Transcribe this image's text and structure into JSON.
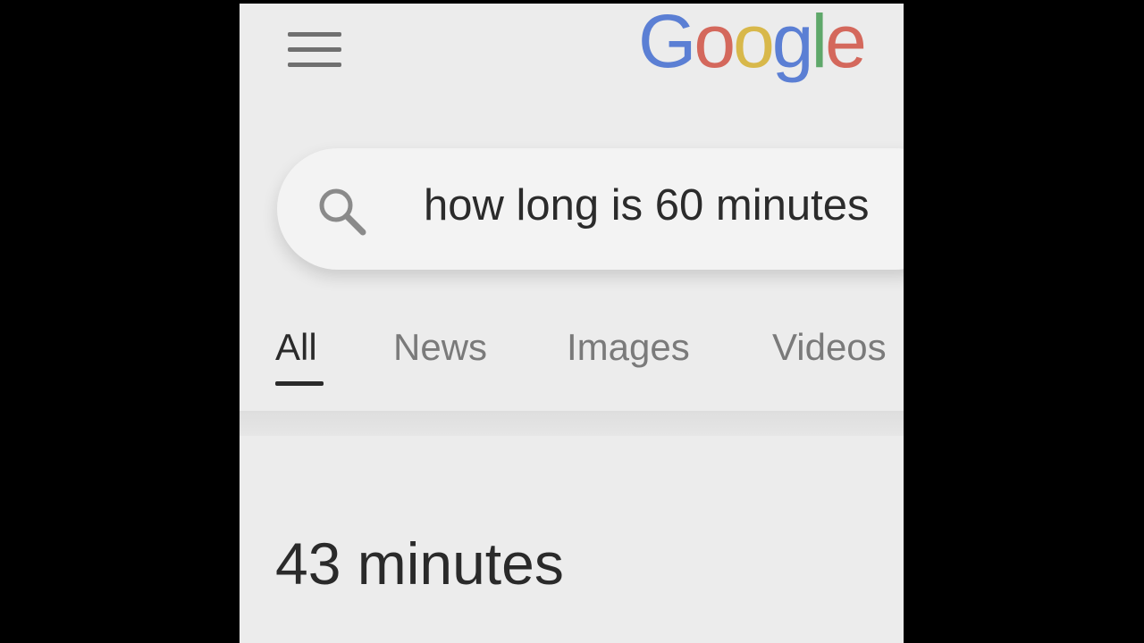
{
  "header": {
    "logo_letters": [
      {
        "char": "G",
        "color": "#5b7fd4"
      },
      {
        "char": "o",
        "color": "#d4685c"
      },
      {
        "char": "o",
        "color": "#d8b84a"
      },
      {
        "char": "g",
        "color": "#5b7fd4"
      },
      {
        "char": "l",
        "color": "#5fa86a"
      },
      {
        "char": "e",
        "color": "#d4685c"
      }
    ],
    "menu_icon": "hamburger-menu-icon"
  },
  "search": {
    "icon": "search-icon",
    "query": "how long is 60 minutes"
  },
  "tabs": [
    {
      "label": "All",
      "active": true
    },
    {
      "label": "News",
      "active": false
    },
    {
      "label": "Images",
      "active": false
    },
    {
      "label": "Videos",
      "active": false
    }
  ],
  "result": {
    "answer": "43 minutes"
  }
}
